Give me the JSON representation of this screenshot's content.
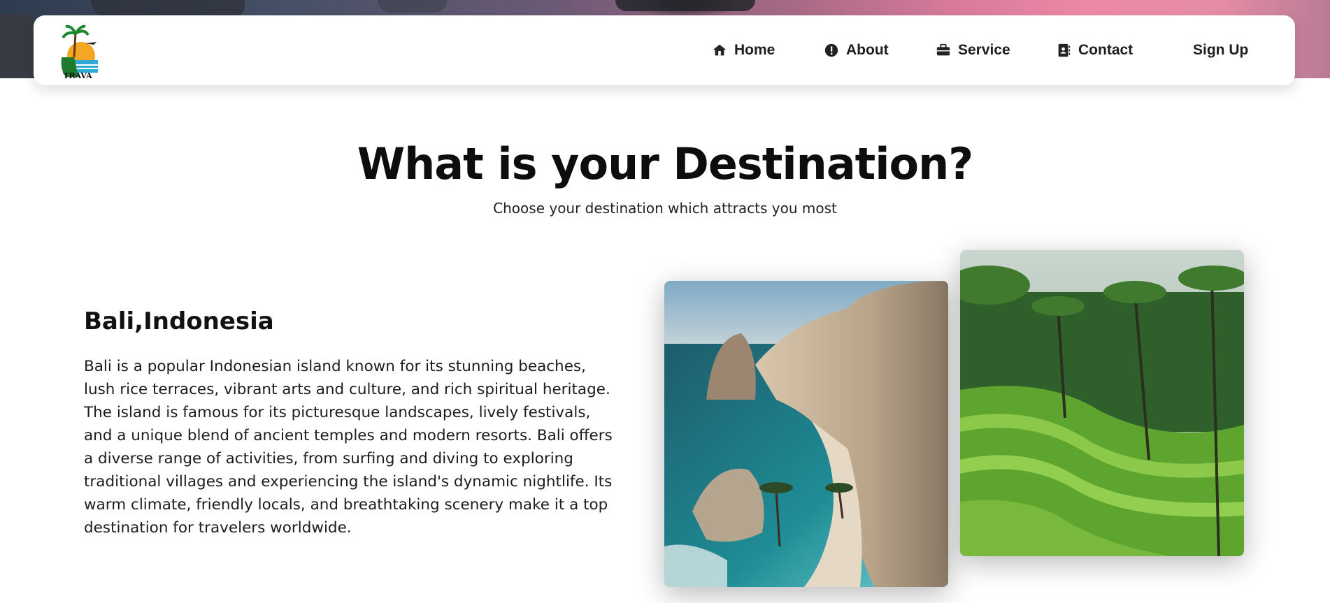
{
  "brand": {
    "logo_text": "TRAVA"
  },
  "nav": {
    "items": [
      {
        "label": "Home",
        "icon": "home-icon"
      },
      {
        "label": "About",
        "icon": "info-icon"
      },
      {
        "label": "Service",
        "icon": "briefcase-icon"
      },
      {
        "label": "Contact",
        "icon": "contact-book-icon"
      }
    ],
    "signup_label": "Sign Up"
  },
  "main": {
    "title": "What is your Destination?",
    "subtitle": "Choose your destination which attracts you most"
  },
  "destination": {
    "name": "Bali,Indonesia",
    "description": "Bali is a popular Indonesian island known for its stunning beaches, lush rice terraces, vibrant arts and culture, and rich spiritual heritage. The island is famous for its picturesque landscapes, lively festivals, and a unique blend of ancient temples and modern resorts. Bali offers a diverse range of activities, from surfing and diving to exploring traditional villages and experiencing the island's dynamic nightlife. Its warm climate, friendly locals, and breathtaking scenery make it a top destination for travelers worldwide.",
    "photos": [
      "coastal-cliff-beach-photo",
      "rice-terrace-photo"
    ]
  }
}
